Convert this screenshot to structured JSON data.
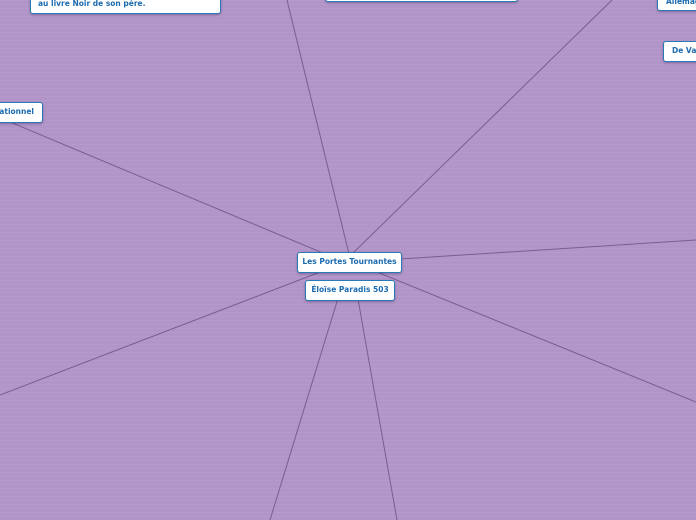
{
  "map": {
    "central_topic": "Les Portes Tournantes",
    "sub_topic": "Éloïse Paradis 503",
    "nodes": {
      "top_left_note": "au livre Noir de son père.",
      "left": "sationnel",
      "top_right_a": "Allemag",
      "right": "De Val",
      "top_center": ""
    },
    "colors": {
      "background": "#b195c8",
      "connector": "#7a5c96",
      "node_border": "#2a7ab8",
      "node_text": "#1c6bb0"
    }
  }
}
